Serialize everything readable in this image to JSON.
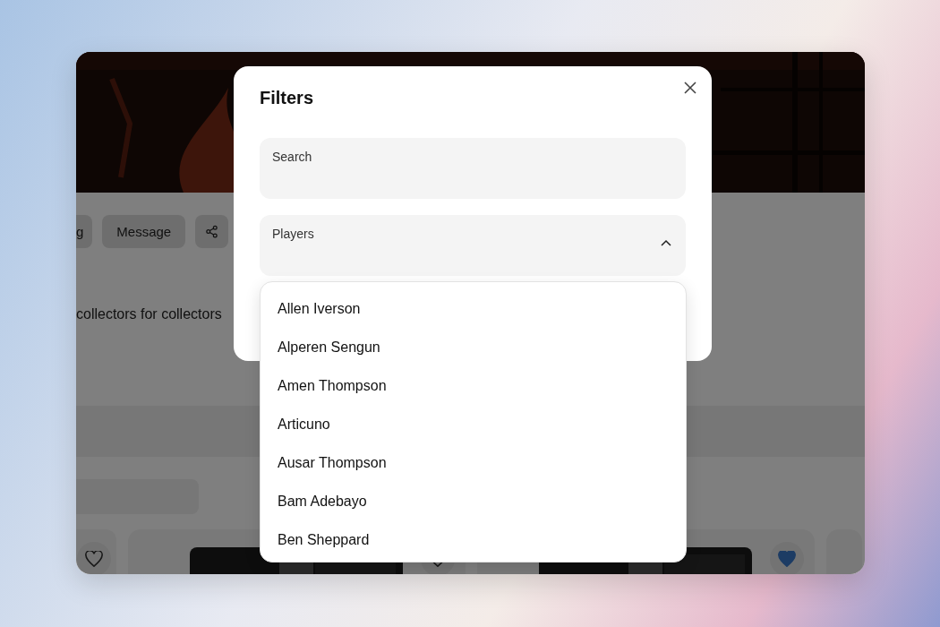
{
  "actions": [
    {
      "label": "g"
    },
    {
      "label": "Message"
    }
  ],
  "description": "collectors for collectors",
  "cards": [
    {
      "kind": "edge",
      "liked": false
    },
    {
      "kind": "item",
      "liked": false
    },
    {
      "kind": "item",
      "liked": true
    },
    {
      "kind": "stub"
    }
  ],
  "modal": {
    "title": "Filters",
    "fields": [
      {
        "kind": "text",
        "label": "Search"
      },
      {
        "kind": "select",
        "label": "Players",
        "expanded": true
      }
    ],
    "options": [
      "Allen Iverson",
      "Alperen Sengun",
      "Amen Thompson",
      "Articuno",
      "Ausar Thompson",
      "Bam Adebayo",
      "Ben Sheppard"
    ]
  }
}
